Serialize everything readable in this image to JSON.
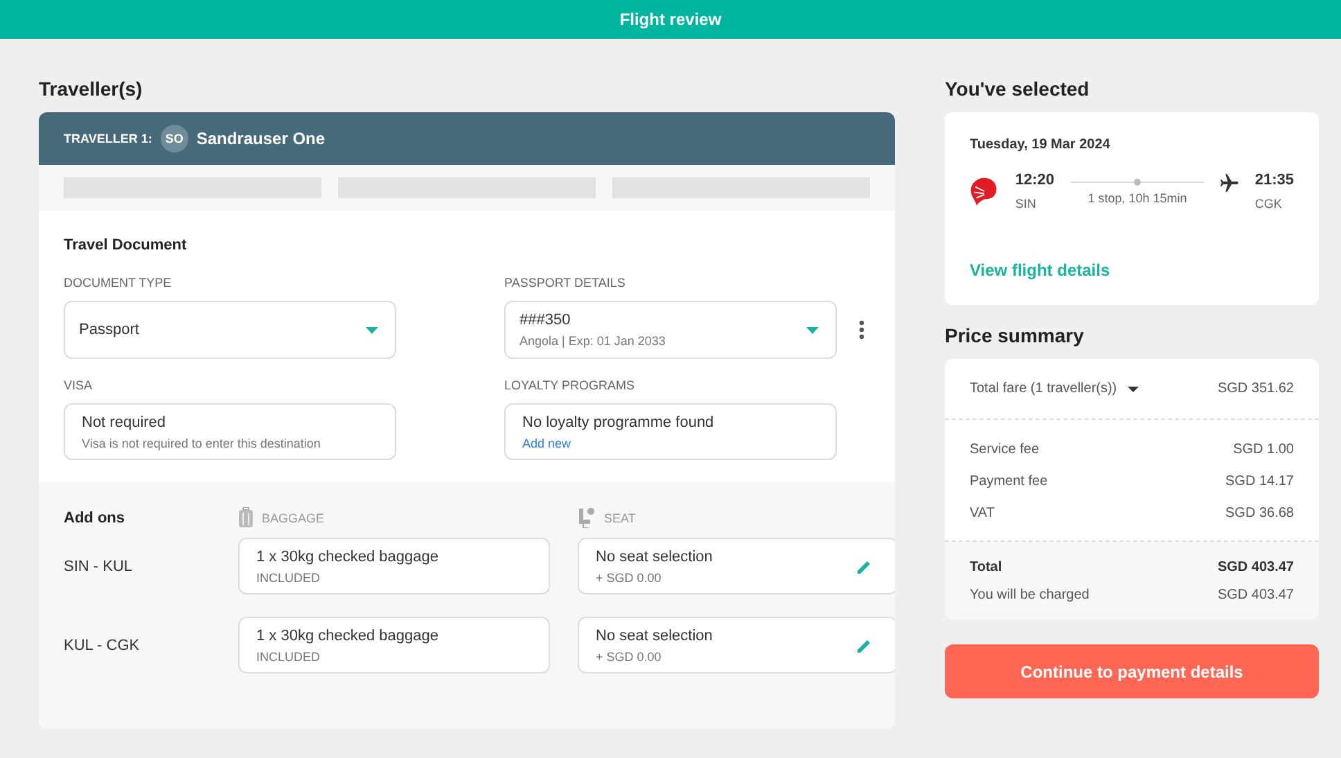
{
  "top_bar": {
    "title": "Flight review"
  },
  "travellers_heading": "Traveller(s)",
  "traveller": {
    "label": "TRAVELLER 1:",
    "initials": "SO",
    "name": "Sandrauser One"
  },
  "travel_document": {
    "title": "Travel Document",
    "fields": [
      {
        "label": "DOCUMENT TYPE",
        "value": "Passport",
        "kind": "dropdown"
      },
      {
        "label": "PASSPORT DETAILS",
        "value": "###350",
        "sub": "Angola | Exp: 01 Jan 2033",
        "kind": "dropdown-menu"
      },
      {
        "label": "VISA",
        "value": "Not required",
        "sub": "Visa is not required to enter this destination",
        "kind": "info"
      },
      {
        "label": "LOYALTY PROGRAMS",
        "value": "No loyalty programme found",
        "link": "Add new",
        "kind": "link"
      }
    ]
  },
  "add_ons": {
    "title": "Add ons",
    "baggage_heading": "BAGGAGE",
    "seat_heading": "SEAT",
    "rows": [
      {
        "route": "SIN - KUL",
        "baggage": "1 x 30kg checked baggage",
        "baggage_note": "INCLUDED",
        "seat": "No seat selection",
        "seat_price": "+ SGD 0.00"
      },
      {
        "route": "KUL - CGK",
        "baggage": "1 x 30kg checked baggage",
        "baggage_note": "INCLUDED",
        "seat": "No seat selection",
        "seat_price": "+ SGD 0.00"
      }
    ]
  },
  "selected_heading": "You've selected",
  "flight": {
    "date": "Tuesday, 19 Mar 2024",
    "depart_time": "12:20",
    "depart_code": "SIN",
    "stops": "1 stop, 10h 15min",
    "arrive_time": "21:35",
    "arrive_code": "CGK",
    "details_link": "View flight details"
  },
  "price_heading": "Price summary",
  "price": {
    "total_fare_label": "Total fare (1 traveller(s))",
    "total_fare": "SGD 351.62",
    "fees": [
      {
        "label": "Service fee",
        "value": "SGD 1.00"
      },
      {
        "label": "Payment fee",
        "value": "SGD 14.17"
      },
      {
        "label": "VAT",
        "value": "SGD 36.68"
      }
    ],
    "total_label": "Total",
    "total": "SGD 403.47",
    "charged_label": "You will be charged",
    "charged": "SGD 403.47"
  },
  "continue_button": "Continue to payment details"
}
